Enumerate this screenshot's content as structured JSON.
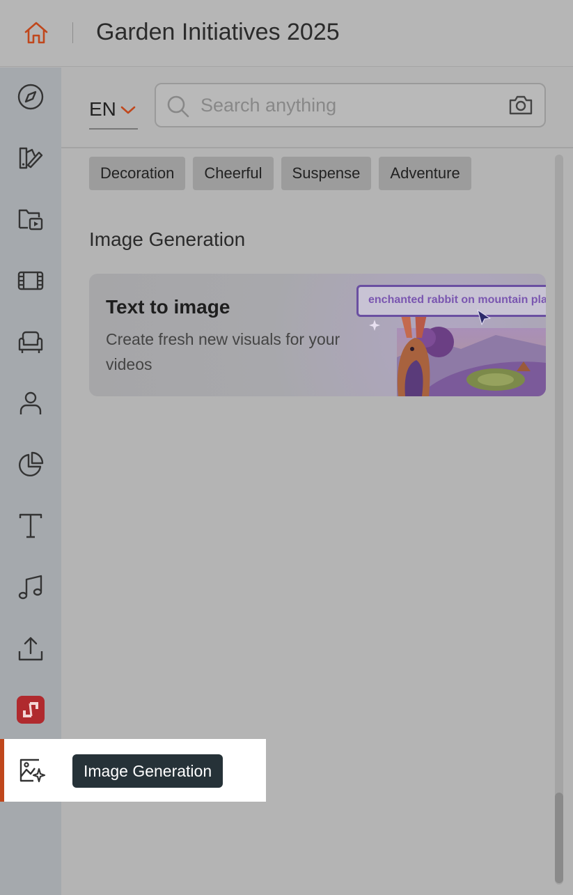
{
  "header": {
    "title": "Garden Initiatives 2025",
    "home_icon": "home-icon"
  },
  "colors": {
    "accent": "#c0471c",
    "tooltip_bg": "#263238",
    "brand_red": "#b02a2e"
  },
  "sidebar": {
    "items": [
      {
        "name": "explore",
        "icon": "compass-icon"
      },
      {
        "name": "design",
        "icon": "design-brush-icon"
      },
      {
        "name": "media-folder",
        "icon": "folder-play-icon"
      },
      {
        "name": "video",
        "icon": "film-icon"
      },
      {
        "name": "elements",
        "icon": "armchair-icon"
      },
      {
        "name": "characters",
        "icon": "person-icon"
      },
      {
        "name": "charts",
        "icon": "pie-chart-icon"
      },
      {
        "name": "text",
        "icon": "text-icon"
      },
      {
        "name": "music",
        "icon": "music-note-icon"
      },
      {
        "name": "upload",
        "icon": "upload-icon"
      },
      {
        "name": "brand-app",
        "icon": "brand-app-icon"
      },
      {
        "name": "image-generation",
        "icon": "image-sparkle-icon",
        "active": true
      }
    ]
  },
  "language": {
    "value": "EN"
  },
  "search": {
    "placeholder": "Search anything"
  },
  "chips": [
    "Decoration",
    "Cheerful",
    "Suspense",
    "Adventure"
  ],
  "section": {
    "title": "Image Generation"
  },
  "card": {
    "title": "Text to image",
    "subtitle": "Create fresh new visuals for your videos",
    "prompt_text": "enchanted rabbit on mountain pla"
  },
  "tooltip": {
    "label": "Image Generation"
  }
}
